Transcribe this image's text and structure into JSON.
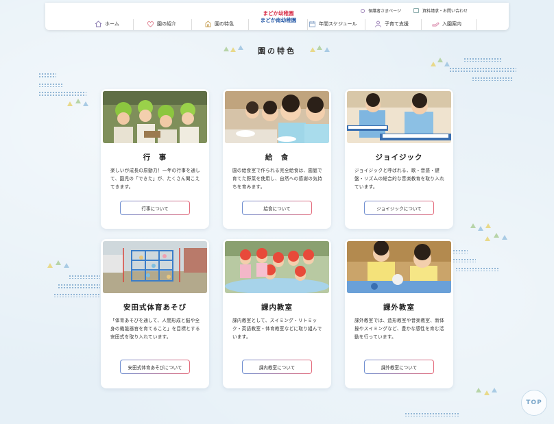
{
  "header": {
    "logo_line1": "まどか幼稚園",
    "logo_line2": "まどか南幼稚園",
    "top_links": [
      {
        "label": "保護者さまページ",
        "icon": "user-icon"
      },
      {
        "label": "資料請求・お問い合わせ",
        "icon": "mail-icon"
      }
    ],
    "nav": [
      {
        "label": "ホーム",
        "icon": "home-icon"
      },
      {
        "label": "園の紹介",
        "icon": "heart-icon"
      },
      {
        "label": "園の特色",
        "icon": "building-icon"
      },
      {
        "label": "年間スケジュール",
        "icon": "calendar-icon"
      },
      {
        "label": "子育て支援",
        "icon": "people-icon"
      },
      {
        "label": "入園案内",
        "icon": "hand-icon"
      }
    ]
  },
  "section": {
    "title": "園の特色"
  },
  "cards": [
    {
      "title": "行　事",
      "desc": "楽しいが成長の原動力！一年の行事を通して、園児の「できた」が、たくさん聞こえてきます。",
      "button": "行事について"
    },
    {
      "title": "給　食",
      "desc": "園の給食室で作られる完全給食は、園庭で育てた野菜を使用し、自然への感謝の気持ちを育みます。",
      "button": "給食について"
    },
    {
      "title": "ジョイジック",
      "desc": "ジョイジックと呼ばれる、歌・音感・鍵盤・リズムの総合的な音楽教育を取り入れています。",
      "button": "ジョイジックについて"
    },
    {
      "title": "安田式体育あそび",
      "desc": "「体育あそびを通して、人間形成と脳や全身の機能器官を育てること」を目標とする安田式を取り入れています。",
      "button": "安田式体育あそびについて"
    },
    {
      "title": "課内教室",
      "desc": "課内教室として、スイミング・リトミック・英語教室・体育教室などに取り組んでいます。",
      "button": "課内教室について"
    },
    {
      "title": "課外教室",
      "desc": "課外教室では、造形教室や音楽教室、新体操やスイミングなど、豊かな感性を育む活動を行っています。",
      "button": "課外教室について"
    }
  ],
  "top_button": "TOP",
  "colors": {
    "background": "#e6f0f7",
    "logo_red": "#d8304a",
    "logo_blue": "#2a5ca8",
    "button_gradient_start": "#6f8fd1",
    "button_gradient_end": "#e46b7c"
  }
}
